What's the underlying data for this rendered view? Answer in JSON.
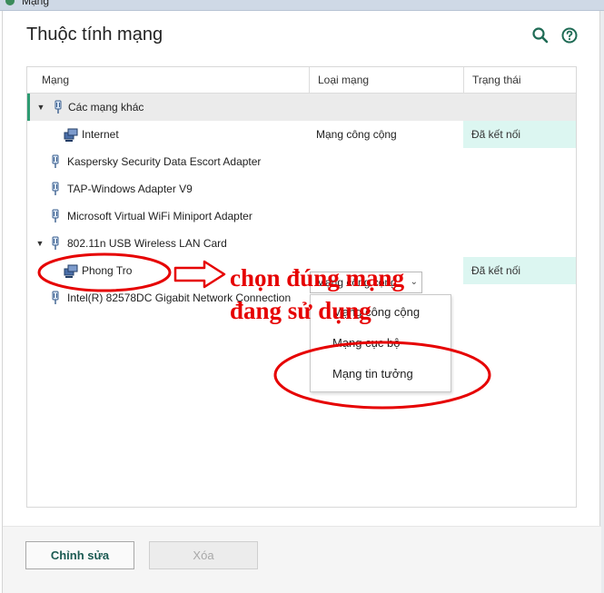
{
  "window": {
    "title": "Mạng"
  },
  "dialog": {
    "title": "Thuộc tính mạng"
  },
  "columns": {
    "network": "Mạng",
    "type": "Loại mạng",
    "status": "Trạng thái"
  },
  "rows": [
    {
      "label": "Các mạng khác",
      "type": "",
      "status": ""
    },
    {
      "label": "Internet",
      "type": "Mạng công cộng",
      "status": "Đã kết nối"
    },
    {
      "label": "Kaspersky Security Data Escort Adapter",
      "type": "",
      "status": ""
    },
    {
      "label": "TAP-Windows Adapter V9",
      "type": "",
      "status": ""
    },
    {
      "label": "Microsoft Virtual WiFi Miniport Adapter",
      "type": "",
      "status": ""
    },
    {
      "label": "802.11n USB Wireless LAN Card",
      "type": "",
      "status": ""
    },
    {
      "label": "Phong Tro",
      "type": "Mạng công cộng",
      "status": "Đã kết nối"
    },
    {
      "label": "Intel(R) 82578DC Gigabit Network Connection",
      "type": "",
      "status": ""
    }
  ],
  "dropdown": {
    "options": [
      "Mạng công cộng",
      "Mạng cục bộ",
      "Mạng tin tưởng"
    ]
  },
  "annotation": {
    "line1": "chọn đúng mạng",
    "line2": "đang sử dụng"
  },
  "buttons": {
    "edit": "Chỉnh sửa",
    "delete": "Xóa"
  },
  "colors": {
    "accent": "#2e9b72",
    "status_bg": "#dcf6f1",
    "annotation": "#e60000"
  }
}
